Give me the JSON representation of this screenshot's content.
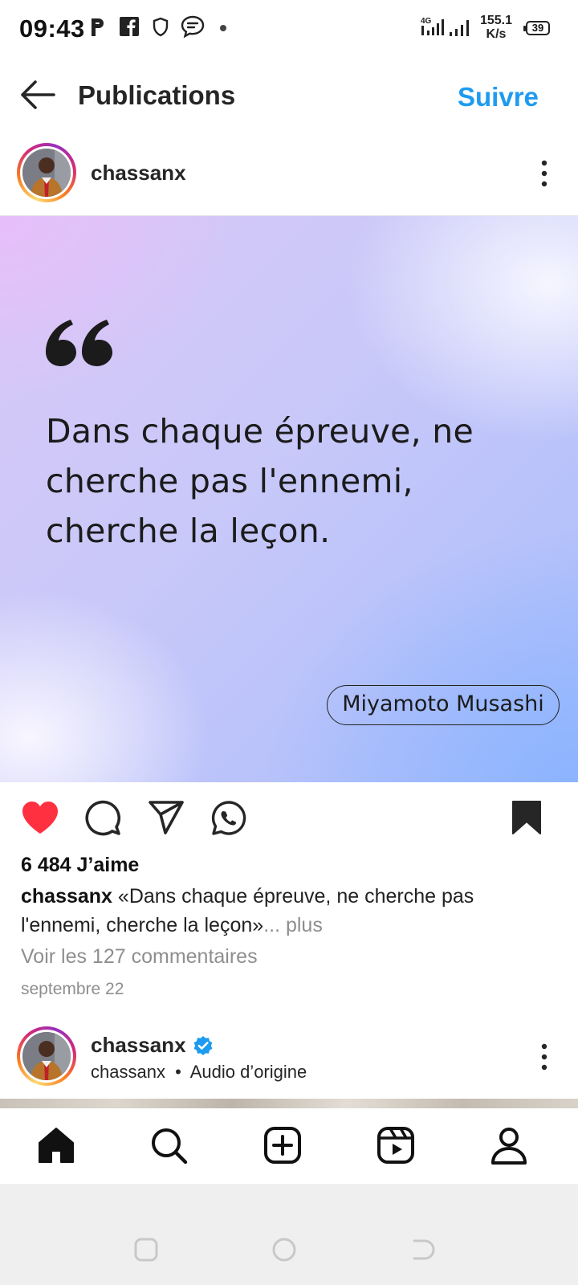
{
  "status_bar": {
    "time": "09:43",
    "network_speed_value": "155.1",
    "network_speed_unit": "K/s",
    "battery": "39",
    "network_type": "4G"
  },
  "header": {
    "title": "Publications",
    "follow_label": "Suivre"
  },
  "post": {
    "username": "chassanx",
    "quote": "Dans chaque épreuve, ne cherche pas l'ennemi, cherche la leçon.",
    "author": "Miyamoto Musashi",
    "liked": true,
    "saved": true,
    "likes": "6 484 J’aime",
    "caption_username": "chassanx",
    "caption_text": " «Dans chaque épreuve, ne cherche pas l'ennemi, cherche la leçon»",
    "caption_more": "... plus",
    "view_comments": "Voir les 127 commentaires",
    "date": "septembre 22"
  },
  "next_post": {
    "username": "chassanx",
    "verified": true,
    "subline_user": "chassanx",
    "subline_separator": "•",
    "audio": "Audio d’origine"
  },
  "colors": {
    "accent": "#1e9bf0",
    "like_red": "#ff3040",
    "verified_blue": "#1d9bf0"
  },
  "bottom_nav": {
    "items": [
      "home-icon",
      "search-icon",
      "new-post-icon",
      "reels-icon",
      "profile-icon"
    ]
  }
}
